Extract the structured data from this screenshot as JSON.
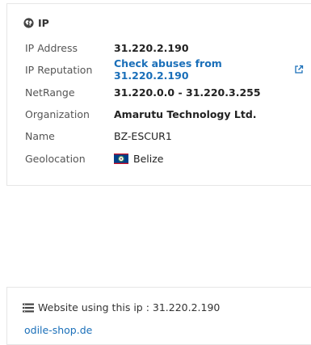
{
  "ip_panel": {
    "title": "IP",
    "rows": [
      {
        "label": "IP Address",
        "value": "31.220.2.190"
      },
      {
        "label": "IP Reputation",
        "value": "Check abuses from 31.220.2.190"
      },
      {
        "label": "NetRange",
        "value": "31.220.0.0 - 31.220.3.255"
      },
      {
        "label": "Organization",
        "value": "Amarutu Technology Ltd."
      },
      {
        "label": "Name",
        "value": "BZ-ESCUR1"
      },
      {
        "label": "Geolocation",
        "value": "Belize"
      }
    ]
  },
  "website_panel": {
    "title": "Website using this ip : 31.220.2.190",
    "sites": [
      "odile-shop.de"
    ]
  },
  "colors": {
    "link": "#1a6fb9",
    "border": "#e6e6e6"
  },
  "icons": {
    "ip_title": "globe-icon",
    "reputation": "external-link-icon",
    "geolocation": "belize-flag-icon",
    "website_title": "list-icon"
  }
}
